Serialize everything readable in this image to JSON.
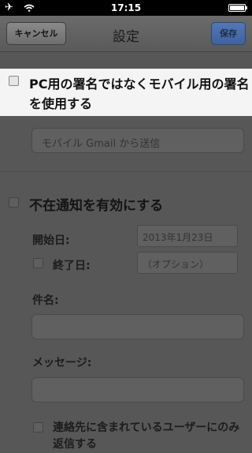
{
  "status_bar": {
    "time": "17:15",
    "airplane_icon": "airplane-icon",
    "wifi_icon": "wifi-icon",
    "battery_icon": "battery-icon"
  },
  "navbar": {
    "title": "設定",
    "cancel_label": "キャンセル",
    "save_label": "保存"
  },
  "signature": {
    "mobile_signature_label": "PC用の署名ではなくモバイル用の署名を使用する",
    "signature_placeholder": "モバイル Gmail から送信"
  },
  "vacation": {
    "enable_label": "不在通知を有効にする",
    "start_label": "開始日:",
    "start_value": "2013年1月23日",
    "end_label": "終了日:",
    "end_value": "（オプション）",
    "subject_label": "件名:",
    "subject_value": "",
    "message_label": "メッセージ:",
    "message_value": "",
    "contacts_only_label": "連絡先に含まれているユーザーにのみ返信する"
  },
  "colors": {
    "highlight_bg": "#f4f4f4",
    "dim_overlay": "#575757",
    "save_button": "#4a6fae"
  }
}
